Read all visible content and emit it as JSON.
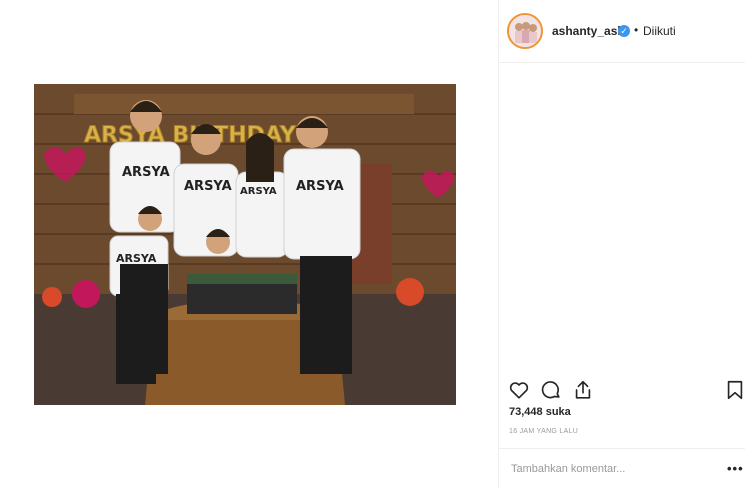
{
  "post": {
    "photo_alt": "",
    "header": {
      "username": "ashanty_ash",
      "verified_icon": "verified-badge-icon",
      "separator": "•",
      "follow_status": "Diikuti"
    },
    "banner_letters": "ARSYA BIRTHDAY",
    "shirt_text": "ARSYA",
    "actions": {
      "like_icon": "heart-icon",
      "comment_icon": "comment-icon",
      "share_icon": "share-icon",
      "save_icon": "bookmark-icon"
    },
    "likes": "73,448 suka",
    "timestamp": "16 JAM YANG LALU",
    "comment_placeholder": "Tambahkan komentar...",
    "more_label": "•••"
  },
  "colors": {
    "accent_blue": "#3897f0",
    "text_primary": "#262626",
    "text_secondary": "#999999",
    "border": "#efefef"
  }
}
